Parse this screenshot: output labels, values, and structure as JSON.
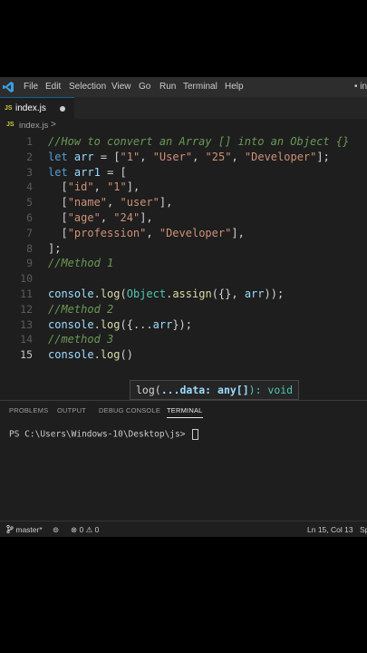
{
  "menubar": {
    "items": [
      "File",
      "Edit",
      "Selection",
      "View",
      "Go",
      "Run",
      "Terminal",
      "Help"
    ],
    "title_right": "• in"
  },
  "tab": {
    "icon": "JS",
    "label": "index.js"
  },
  "breadcrumb": {
    "icon": "JS",
    "label": "index.js",
    "chevron": ">"
  },
  "editor": {
    "line_numbers": [
      "1",
      "2",
      "3",
      "4",
      "5",
      "6",
      "7",
      "8",
      "9",
      "10",
      "11",
      "12",
      "13",
      "14",
      "15"
    ],
    "active_line": "15",
    "lines": [
      "//How to convert an Array [] into an Object {}",
      "let arr = [\"1\", \"User\", \"25\", \"Developer\"];",
      "let arr1 = [",
      "  [\"id\", \"1\"],",
      "  [\"name\", \"user\"],",
      "  [\"age\", \"24\"],",
      "  [\"profession\", \"Developer\"],",
      "];",
      "//Method 1",
      "",
      "console.log(Object.assign({}, arr));",
      "//Method 2",
      "console.log({...arr});",
      "//method 3",
      "console.log()"
    ]
  },
  "signature_hint": {
    "prefix": "log(",
    "param": "...data: any[]",
    "suffix": "): void"
  },
  "panel": {
    "tabs": [
      "PROBLEMS",
      "OUTPUT",
      "DEBUG CONSOLE",
      "TERMINAL"
    ],
    "active_tab": "TERMINAL",
    "prompt": "PS C:\\Users\\Windows-10\\Desktop\\js>"
  },
  "statusbar": {
    "branch": "master*",
    "errors": "0",
    "warnings": "0",
    "position": "Ln 15, Col 13",
    "right_cut": "Sp"
  },
  "colors": {
    "editor_bg": "#1e1e1e",
    "keyword": "#569cd6",
    "string": "#ce9178",
    "comment": "#6a9955",
    "function": "#dcdcaa"
  }
}
